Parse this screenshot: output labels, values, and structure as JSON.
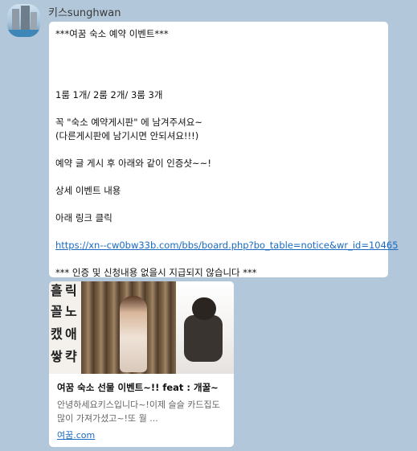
{
  "sender": {
    "name": "키스sunghwan"
  },
  "message": {
    "lines": [
      "***여꿈 숙소 예약 이벤트***",
      "1룸 1개/ 2룸 2개/ 3룸 3개",
      "꼭  \"숙소 예약게시판\" 에 남겨주셔요~",
      "(다른게시판에 남기시면 안되셔요!!!)",
      "예약 글 게시 후 아래와 같이 인증샷~~!",
      "상세 이벤트 내용",
      "아래 링크 클릭",
      "*** 인증 및 신청내용 없을시 지급되지 않습니다 ***"
    ],
    "link": "https://xn--cw0bw33b.com/bbs/board.php?bo_table=notice&wr_id=10465"
  },
  "preview": {
    "title": "여꿈 숙소 선물 이벤트~!! feat : 개꿀~",
    "description": "안녕하세요키스입니다~!이제 슬슬 카드집도 많이 가져가셨고~!또 월 ...",
    "source": "여꿈.com",
    "image_glyphs": [
      "흘",
      "꼴",
      "캤",
      "쌓",
      "릭",
      "노",
      "애",
      "캭"
    ]
  }
}
